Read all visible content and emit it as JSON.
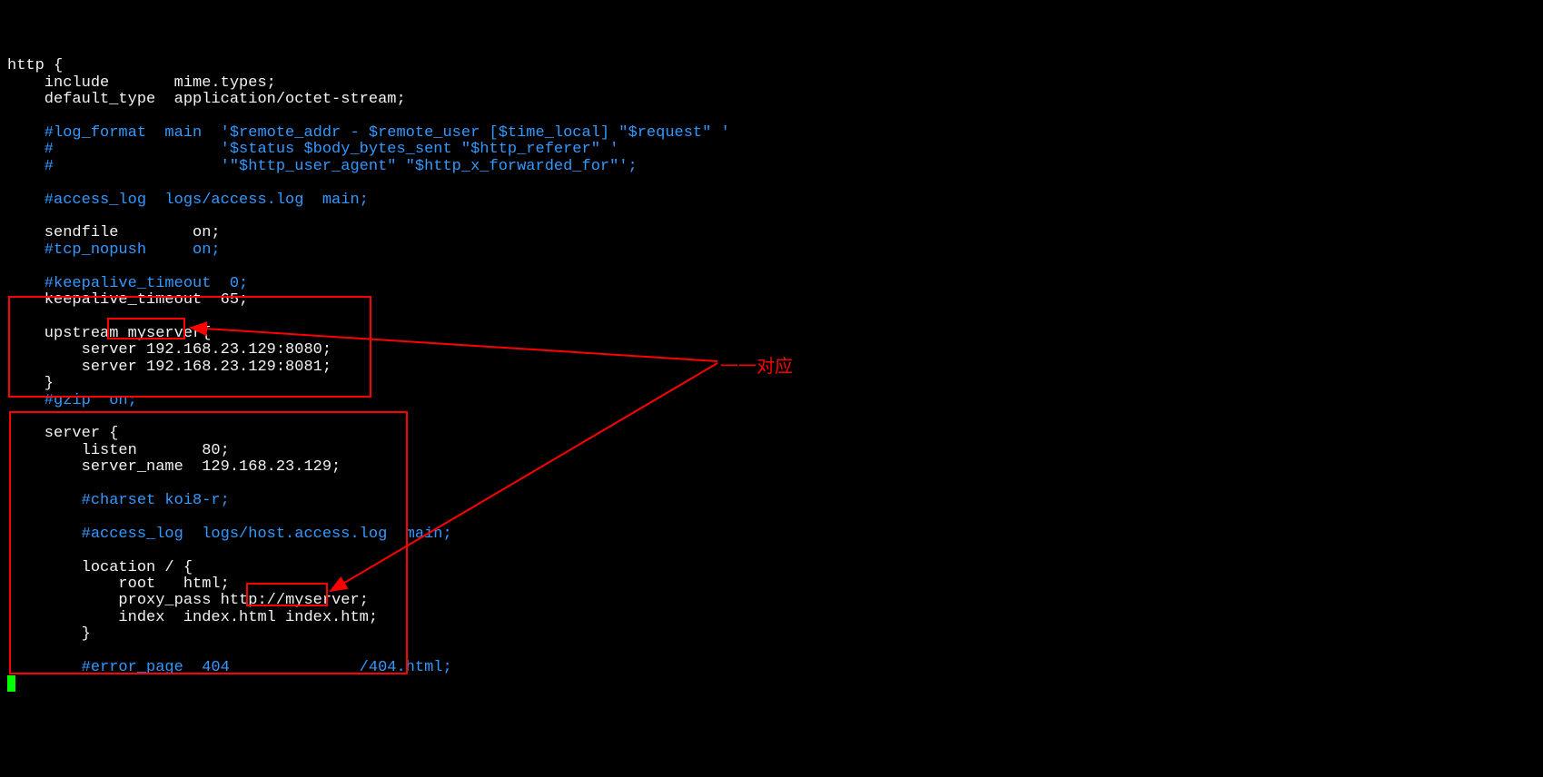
{
  "lines": {
    "l1": "http {",
    "l2": "    include       mime.types;",
    "l3": "    default_type  application/octet-stream;",
    "l4": "",
    "l5": "    #log_format  main  '$remote_addr - $remote_user [$time_local] \"$request\" '",
    "l6": "    #                  '$status $body_bytes_sent \"$http_referer\" '",
    "l7": "    #                  '\"$http_user_agent\" \"$http_x_forwarded_for\"';",
    "l8": "",
    "l9": "    #access_log  logs/access.log  main;",
    "l10": "",
    "l11": "    sendfile        on;",
    "l12": "    #tcp_nopush     on;",
    "l13": "",
    "l14": "    #keepalive_timeout  0;",
    "l15": "    keepalive_timeout  65;",
    "l16": "",
    "l17": "    upstream myserver{",
    "l18": "        server 192.168.23.129:8080;",
    "l19": "        server 192.168.23.129:8081;",
    "l20": "    }",
    "l21": "    #gzip  on;",
    "l22": "",
    "l23": "    server {",
    "l24": "        listen       80;",
    "l25": "        server_name  129.168.23.129;",
    "l26": "",
    "l27": "        #charset koi8-r;",
    "l28": "",
    "l29": "        #access_log  logs/host.access.log  main;",
    "l30": "",
    "l31": "        location / {",
    "l32": "            root   html;",
    "l33": "            proxy_pass http://myserver;",
    "l34": "            index  index.html index.htm;",
    "l35": "        }",
    "l36": "",
    "l37": "        #error_page  404              /404.html;"
  },
  "partial": {
    "l17a": "    upstream ",
    "l17b": "myserver",
    "l17c": "{",
    "l33a": "            proxy_pass http://",
    "l33b": "myserver",
    "l33c": ";"
  },
  "annotation": {
    "label": "一一对应"
  },
  "colors": {
    "comment": "#3399ff",
    "text": "#f2f2f2",
    "highlight": "#ff0000",
    "cursor": "#00ff00"
  }
}
